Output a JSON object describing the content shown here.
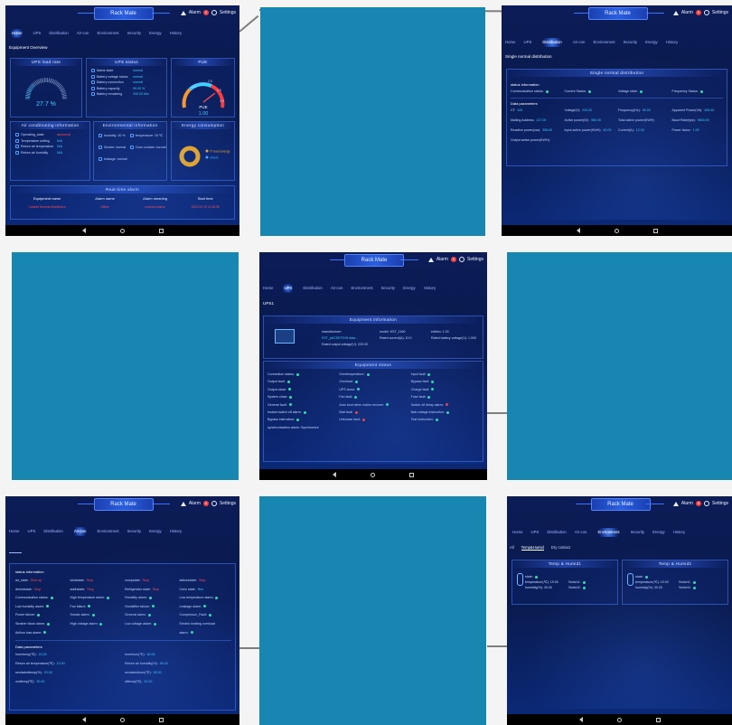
{
  "app": {
    "title": "Rack Mate",
    "alarm_label": "Alarm",
    "alarm_count": "5",
    "settings_label": "Settings"
  },
  "nav_tabs": [
    "Home",
    "UPS",
    "Distribution",
    "Air-con",
    "Environment",
    "Security",
    "Energy",
    "History"
  ],
  "home": {
    "page_title": "Equipment Overview",
    "ups_load": {
      "title": "UPS load rate",
      "value": "27.7 %"
    },
    "ups_status": {
      "title": "UPS status",
      "rows": [
        {
          "label": "Mains state",
          "value": "normal"
        },
        {
          "label": "Battery voltage status",
          "value": "normal"
        },
        {
          "label": "Battery connection",
          "value": "normal"
        },
        {
          "label": "Battery capacity",
          "value": "99.00 %"
        },
        {
          "label": "Battery remaining",
          "value": "200.00 Min"
        }
      ]
    },
    "pue": {
      "title": "PUE",
      "label": "PUE",
      "value": "1.00",
      "ticks": [
        "1.5",
        "2.0",
        "2.5",
        "3.0"
      ]
    },
    "aircon": {
      "title": "Air conditioning information",
      "rows": [
        {
          "label": "Operating_state",
          "value": "abnormal",
          "alert": true
        },
        {
          "label": "Temperature setting",
          "value": "N/A",
          "alert": false
        },
        {
          "label": "Return air temperature",
          "value": "N/A",
          "alert": false
        },
        {
          "label": "Return air humidity",
          "value": "N/A",
          "alert": false
        }
      ]
    },
    "env": {
      "title": "Environmental information",
      "humidity": "humidity: 30 %",
      "temperature": "temperature: 19 ℃",
      "smoke": "Smoke: normal",
      "door": "Door contact: normal",
      "leakage": "leakage: normal"
    },
    "energy": {
      "title": "Energy consumption",
      "legend1": "IT load energy",
      "legend2": "others"
    },
    "alarm": {
      "title": "Real-time alarm",
      "columns": [
        "Equipment name",
        "Alarm name",
        "Alarm meaning",
        "Start time"
      ],
      "row": [
        "Cabinet thermal distribution",
        "Offline",
        "communication",
        "2023-09-19 11:28:35"
      ]
    }
  },
  "distribution": {
    "page_title": "Single normal distribution",
    "panel_title": "Single normal distribution",
    "status_title": "status information",
    "status": [
      "Communication status:",
      "Current Status:",
      "Voltage state:",
      "Frequency Status:"
    ],
    "params_title": "Data parameters",
    "params": [
      {
        "l": "CT:",
        "v": "100"
      },
      {
        "l": "Voltage(V):",
        "v": "220.00"
      },
      {
        "l": "Frequency(Hz):",
        "v": "50.00"
      },
      {
        "l": "Apparent Power(VA):",
        "v": "495.00"
      },
      {
        "l": "Mailing Address:",
        "v": "127.00"
      },
      {
        "l": "Active power(W):",
        "v": "360.00"
      },
      {
        "l": "Total active power(KWH):",
        "v": ""
      },
      {
        "l": "Baud Rate(bps):",
        "v": "9600.00"
      },
      {
        "l": "Reactive power(var):",
        "v": "308.00"
      },
      {
        "l": "Input active power(KWH):",
        "v": "50.00"
      },
      {
        "l": "Current(A):",
        "v": "12.00"
      },
      {
        "l": "Power factor:",
        "v": "1.00"
      },
      {
        "l": "Output active power(KWH):",
        "v": ""
      }
    ]
  },
  "ups": {
    "page_title": "UPS1",
    "info_title": "Equipment information",
    "manufacturer_label": "manufacturer:",
    "manufacturer_value": "KST_pbCDEFGHI.data...",
    "model": "model: KST_1160",
    "edition": "edition: 1.00",
    "rated_current": "Rated current(A): 10.0",
    "rated_battery": "Rated battery voltage(V): 1.000",
    "rated_output": "Rated output voltage(V): 220.00",
    "status_title": "Equipment status",
    "status": [
      {
        "l": "Connection status:",
        "s": "ok"
      },
      {
        "l": "Overtemperature:",
        "s": "ok"
      },
      {
        "l": "Input fault:",
        "s": "ok"
      },
      {
        "l": "Output fault:",
        "s": "ok"
      },
      {
        "l": "Overload:",
        "s": "ok"
      },
      {
        "l": "Bypass fault:",
        "s": "ok"
      },
      {
        "l": "Output close:",
        "s": "ok"
      },
      {
        "l": "UPS close:",
        "s": "ok"
      },
      {
        "l": "Charge fault:",
        "s": "ok"
      },
      {
        "l": "System close:",
        "s": "ok"
      },
      {
        "l": "Fan fault:",
        "s": "ok"
      },
      {
        "l": "Fuse fault:",
        "s": "ok"
      },
      {
        "l": "General fault:",
        "s": "ok"
      },
      {
        "l": "Auto boot when mains recover:",
        "s": "ok"
      },
      {
        "l": "Switch off delay alarm:",
        "s": "alarm"
      },
      {
        "l": "Instant switch off alarm:",
        "s": "ok"
      },
      {
        "l": "Batt fault:",
        "s": "alarm"
      },
      {
        "l": "Batt voltage instruction:",
        "s": "ok"
      },
      {
        "l": "Bypass instruction:",
        "s": "ok"
      },
      {
        "l": "Unknown fault:",
        "s": "alarm"
      },
      {
        "l": "Test instruction:",
        "s": "ok"
      }
    ],
    "sync": "synchronization alarm: Synchronize"
  },
  "aircon_page": {
    "status_title": "status information",
    "status": [
      {
        "l": "air_state:",
        "v": "Shut up",
        "t": "text"
      },
      {
        "l": "windstate:",
        "v": "Stop",
        "t": "text"
      },
      {
        "l": "compstate:",
        "v": "Stop",
        "t": "text"
      },
      {
        "l": "aidhedstate:",
        "v": "Stop",
        "t": "text"
      },
      {
        "l": "dehedstate:",
        "v": "Stop",
        "t": "text"
      },
      {
        "l": "addhstate:",
        "v": "Stop",
        "t": "text"
      },
      {
        "l": "Refrigerator state:",
        "v": "Stop",
        "t": "text"
      },
      {
        "l": "Crew state:",
        "v": "Run",
        "t": "text"
      },
      {
        "l": "Communication status:",
        "v": "",
        "t": "ok"
      },
      {
        "l": "High temperature alarm:",
        "v": "",
        "t": "ok"
      },
      {
        "l": "Humidity alarm:",
        "v": "",
        "t": "ok"
      },
      {
        "l": "Low temperature alarm:",
        "v": "",
        "t": "ok"
      },
      {
        "l": "Low humidity alarm:",
        "v": "",
        "t": "ok"
      },
      {
        "l": "Fan failure:",
        "v": "",
        "t": "ok"
      },
      {
        "l": "Humidifier failure:",
        "v": "",
        "t": "ok"
      },
      {
        "l": "Leakage alarm:",
        "v": "",
        "t": "ok"
      },
      {
        "l": "Power failure:",
        "v": "",
        "t": "ok"
      },
      {
        "l": "Smoke alarm:",
        "v": "",
        "t": "ok"
      },
      {
        "l": "General alarm:",
        "v": "",
        "t": "ok"
      },
      {
        "l": "Compressor_Fault:",
        "v": "",
        "t": "ok"
      },
      {
        "l": "Strainer block alarm:",
        "v": "",
        "t": "ok"
      },
      {
        "l": "High voltage alarm:",
        "v": "",
        "t": "ok"
      },
      {
        "l": "Low voltage alarm:",
        "v": "",
        "t": "ok"
      },
      {
        "l": "Electric heating overload",
        "v": "",
        "t": "none"
      },
      {
        "l": "Airflow loss alarm:",
        "v": "",
        "t": "ok"
      },
      {
        "l": "",
        "v": "",
        "t": "none"
      },
      {
        "l": "",
        "v": "",
        "t": "none"
      },
      {
        "l": "alarm:",
        "v": "",
        "t": "ok"
      }
    ],
    "params_title": "Data parameters",
    "params": [
      {
        "l": "Innertemp(℃):",
        "v": "20.00"
      },
      {
        "l": "Innerhum(℃):",
        "v": "60.00"
      },
      {
        "l": "Return air temperature(℃):",
        "v": "10.00"
      },
      {
        "l": "Return air humidity(%):",
        "v": "55.00"
      },
      {
        "l": "sendwindtemp(%):",
        "v": "20.00"
      },
      {
        "l": "sendwindhum(℃):",
        "v": "65.00"
      },
      {
        "l": "ondtemp(℃):",
        "v": "30.00"
      },
      {
        "l": "offtemp(℃):",
        "v": "40.00"
      }
    ]
  },
  "environment": {
    "sub_tabs": [
      "All",
      "Temp&Humid",
      "Dry contact"
    ],
    "cards": [
      {
        "title": "Temp & Humid1",
        "state": "state:",
        "temp": "temperature(℃): 19.00",
        "hum": "humidity(%): 30.00",
        "sw1": "Switch1:",
        "sw2": "Switch2:"
      },
      {
        "title": "Temp & Humid2",
        "state": "state:",
        "temp": "temperature(℃): 19.00",
        "hum": "humidity(%): 30.00",
        "sw1": "Switch1:",
        "sw2": "Switch2:"
      }
    ]
  },
  "icons": {
    "alarm": "warning-triangle-icon",
    "settings": "gear-icon",
    "back": "triangle-back-icon",
    "home": "circle-home-icon",
    "recent": "square-recent-icon"
  },
  "colors": {
    "background": "#0b1c57",
    "accent": "#3fd0ff",
    "ok": "#32e0a8",
    "alarm": "#ff3b3b",
    "blank_tile": "#1786b0"
  }
}
